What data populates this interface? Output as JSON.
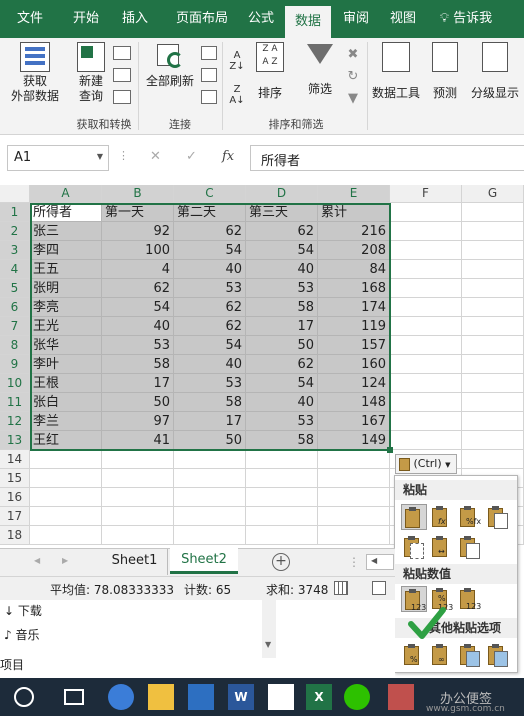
{
  "ribbon_tabs": [
    "文件",
    "开始",
    "插入",
    "页面布局",
    "公式",
    "数据",
    "审阅",
    "视图",
    "告诉我"
  ],
  "active_tab": "数据",
  "ribbon": {
    "get_data": "获取\n外部数据",
    "new_query": "新建\n查询",
    "refresh_all": "全部刷新",
    "sort": "排序",
    "filter": "筛选",
    "data_tools": "数据工具",
    "forecast": "预测",
    "outline": "分级显示",
    "groups": [
      "获取和转换",
      "连接",
      "排序和筛选"
    ]
  },
  "formula_bar": {
    "name_box": "A1",
    "fx": "fx",
    "content": "所得者"
  },
  "columns": [
    "A",
    "B",
    "C",
    "D",
    "E",
    "F",
    "G"
  ],
  "rows": [
    "1",
    "2",
    "3",
    "4",
    "5",
    "6",
    "7",
    "8",
    "9",
    "10",
    "11",
    "12",
    "13",
    "14",
    "15",
    "16",
    "17",
    "18"
  ],
  "table": {
    "headers": [
      "所得者",
      "第一天",
      "第二天",
      "第三天",
      "累计"
    ],
    "data": [
      [
        "张三",
        "92",
        "62",
        "62",
        "216"
      ],
      [
        "李四",
        "100",
        "54",
        "54",
        "208"
      ],
      [
        "王五",
        "4",
        "40",
        "40",
        "84"
      ],
      [
        "张明",
        "62",
        "53",
        "53",
        "168"
      ],
      [
        "李亮",
        "54",
        "62",
        "58",
        "174"
      ],
      [
        "王光",
        "40",
        "62",
        "17",
        "119"
      ],
      [
        "张华",
        "53",
        "54",
        "50",
        "157"
      ],
      [
        "李叶",
        "58",
        "40",
        "62",
        "160"
      ],
      [
        "王根",
        "17",
        "53",
        "54",
        "124"
      ],
      [
        "张白",
        "50",
        "58",
        "40",
        "148"
      ],
      [
        "李兰",
        "97",
        "17",
        "53",
        "167"
      ],
      [
        "王红",
        "41",
        "50",
        "58",
        "149"
      ]
    ]
  },
  "sheet_tabs": [
    "Sheet1",
    "Sheet2"
  ],
  "active_sheet": "Sheet2",
  "status": {
    "average": "平均值: 78.08333333",
    "count": "计数: 65",
    "sum": "求和: 3748"
  },
  "paste_button": "(Ctrl)",
  "paste_menu": {
    "section1": "粘贴",
    "section2": "粘贴数值",
    "section3": "其他粘贴选项"
  },
  "explorer": [
    "下载",
    "音乐",
    "项目"
  ],
  "watermark": "办公便签",
  "watermark_url": "www.gsm.com.cn",
  "colors": {
    "accent": "#217346",
    "selection": "#c8c8c8",
    "check": "#2ea043"
  }
}
